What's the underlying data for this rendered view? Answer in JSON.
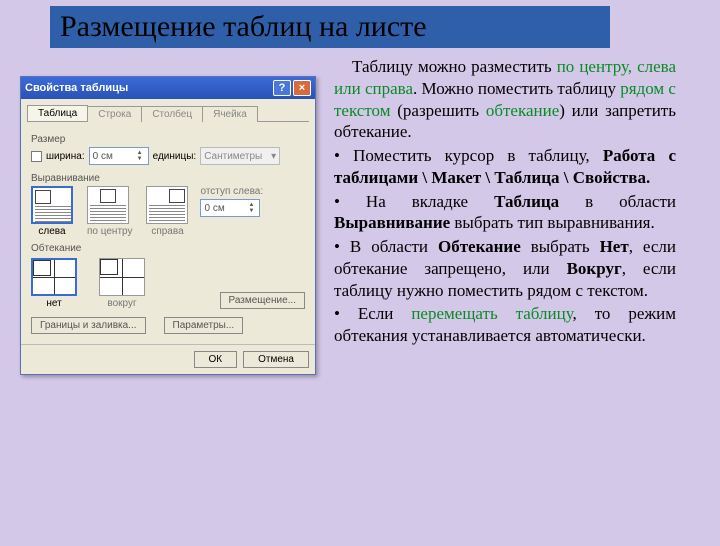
{
  "title": "Размещение таблиц на листе",
  "dialog": {
    "title": "Свойства таблицы",
    "help": "?",
    "close": "×",
    "tabs": {
      "t1": "Таблица",
      "t2": "Строка",
      "t3": "Столбец",
      "t4": "Ячейка"
    },
    "size_section": "Размер",
    "width_cb": "ширина:",
    "width_val": "0 см",
    "unit_label": "единицы:",
    "unit_val": "Сантиметры",
    "align_section": "Выравнивание",
    "align": {
      "left": "слева",
      "center": "по центру",
      "right": "справа"
    },
    "indent_label": "отступ слева:",
    "indent_val": "0 см",
    "wrap_section": "Обтекание",
    "wrap": {
      "none": "нет",
      "around": "вокруг"
    },
    "btn_pos": "Размещение...",
    "btn_borders": "Границы и заливка...",
    "btn_params": "Параметры...",
    "ok": "ОК",
    "cancel": "Отмена"
  },
  "body": {
    "p1a": "Таблицу можно разместить ",
    "p1b": "по центру, слева или справа",
    "p1c": ". Можно поместить таблицу ",
    "p1d": "рядом с текстом",
    "p1e": " (разрешить ",
    "p1f": "обтекание",
    "p1g": ") или запретить обтекание.",
    "b1a": "• Поместить курсор в таблицу, ",
    "b1b": "Работа с таблицами \\ Макет \\ Таблица \\ Свойства.",
    "b2a": "• На вкладке ",
    "b2b": "Таблица",
    "b2c": " в области ",
    "b2d": "Выравнивание",
    "b2e": " выбрать тип выравнивания.",
    "b3a": "• В области ",
    "b3b": "Обтекание",
    "b3c": " выбрать ",
    "b3d": "Нет",
    "b3e": ", если обтекание запрещено, или ",
    "b3f": "Вокруг",
    "b3g": ", если таблицу нужно поместить рядом с текстом.",
    "b4a": "• Если ",
    "b4b": "перемещать таблицу",
    "b4c": ", то режим обтекания устанавливается автоматически."
  }
}
